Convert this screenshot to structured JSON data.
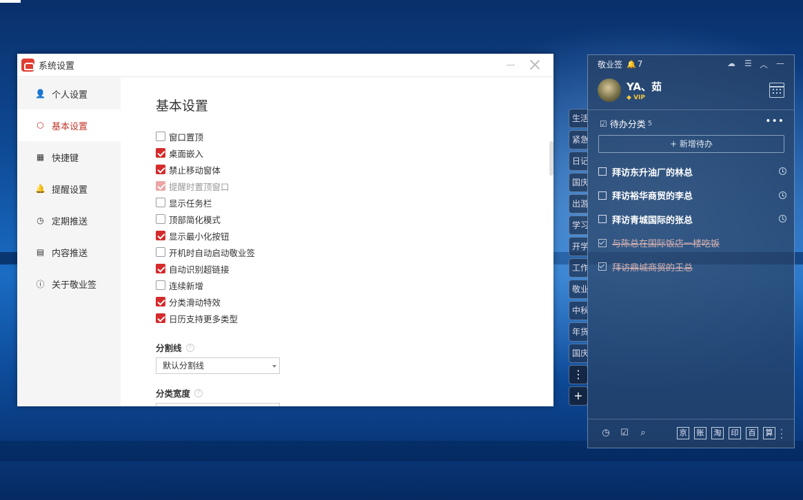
{
  "settings_window": {
    "title": "系统设置",
    "sidebar": [
      {
        "label": "个人设置",
        "icon": "user-icon",
        "glyph": "👤",
        "active": false
      },
      {
        "label": "基本设置",
        "icon": "settings-icon",
        "glyph": "⬡",
        "active": true
      },
      {
        "label": "快捷键",
        "icon": "keyboard-icon",
        "glyph": "▦",
        "active": false
      },
      {
        "label": "提醒设置",
        "icon": "bell-icon",
        "glyph": "🔔",
        "active": false
      },
      {
        "label": "定期推送",
        "icon": "schedule-icon",
        "glyph": "◷",
        "active": false
      },
      {
        "label": "内容推送",
        "icon": "content-icon",
        "glyph": "▤",
        "active": false
      },
      {
        "label": "关于敬业签",
        "icon": "info-icon",
        "glyph": "ⓘ",
        "active": false
      }
    ],
    "heading": "基本设置",
    "options": [
      {
        "label": "窗口置顶",
        "checked": false,
        "disabled": false
      },
      {
        "label": "桌面嵌入",
        "checked": true,
        "disabled": false
      },
      {
        "label": "禁止移动窗体",
        "checked": true,
        "disabled": false
      },
      {
        "label": "提醒时置顶窗口",
        "checked": true,
        "disabled": true
      },
      {
        "label": "显示任务栏",
        "checked": false,
        "disabled": false
      },
      {
        "label": "顶部简化模式",
        "checked": false,
        "disabled": false
      },
      {
        "label": "显示最小化按钮",
        "checked": true,
        "disabled": false
      },
      {
        "label": "开机时自动启动敬业签",
        "checked": false,
        "disabled": false
      },
      {
        "label": "自动识别超链接",
        "checked": true,
        "disabled": false
      },
      {
        "label": "连续新增",
        "checked": false,
        "disabled": false
      },
      {
        "label": "分类滑动特效",
        "checked": true,
        "disabled": false
      },
      {
        "label": "日历支持更多类型",
        "checked": true,
        "disabled": false
      }
    ],
    "divider_label": "分割线",
    "divider_value": "默认分割线",
    "width_label": "分类宽度",
    "help_glyph": "?"
  },
  "side_tabs": [
    "生活",
    "紧急",
    "日记",
    "国庆",
    "出游",
    "学习",
    "开学",
    "工作",
    "敬业",
    "中秋",
    "年货",
    "国庆"
  ],
  "side_tab_buttons": [
    "⋮",
    "+"
  ],
  "widget": {
    "app_name": "敬业签",
    "notification_count": "7",
    "user_name": "YA、茹",
    "vip_label": "VIP",
    "category": "待办分类",
    "category_count": "5",
    "add_label": "+ 新增待办",
    "todos": [
      {
        "text": "拜访东升油厂的林总",
        "done": false
      },
      {
        "text": "拜访裕华商贸的李总",
        "done": false
      },
      {
        "text": "拜访青城国际的张总",
        "done": false
      },
      {
        "text": "与陈总在国际饭店一楼吃饭",
        "done": true
      },
      {
        "text": "拜访鼎城商贸的王总",
        "done": true
      }
    ],
    "footer_tools": [
      "京",
      "账",
      "淘",
      "印",
      "百",
      "算"
    ]
  }
}
